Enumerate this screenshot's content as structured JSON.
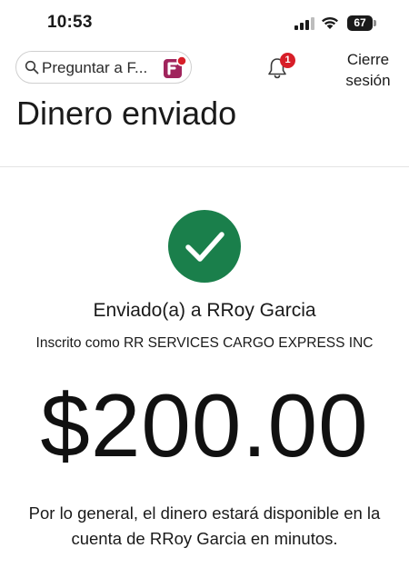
{
  "status_bar": {
    "time": "10:53",
    "battery_level": "67",
    "icons": [
      "signal-icon",
      "wifi-icon",
      "battery-icon"
    ]
  },
  "header": {
    "search_text": "Preguntar a F...",
    "search_icon": "search-icon",
    "assistant_icon": "fargo-assistant-icon",
    "notification_count": "1",
    "logout_label": "Cierre sesión"
  },
  "page": {
    "title": "Dinero enviado"
  },
  "confirmation": {
    "status_icon": "check-circle-icon",
    "recipient_line": "Enviado(a) a RRoy Garcia",
    "enrolled_line": "Inscrito como RR SERVICES CARGO EXPRESS INC",
    "amount": "$200.00",
    "availability_note": "Por lo general, el dinero estará disponible en la cuenta de RRoy Garcia en minutos."
  },
  "colors": {
    "success_green": "#1a7f4b",
    "badge_red": "#d71e28",
    "assistant_purple": "#a0245c",
    "text": "#1a1a1a"
  }
}
